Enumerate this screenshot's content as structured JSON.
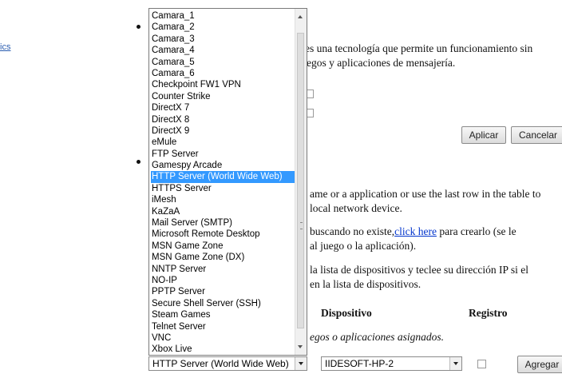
{
  "left_link": "ics",
  "paragraph1": {
    "line1": "es una tecnología que permite un funcionamiento sin",
    "line2": "egos y aplicaciones de mensajería."
  },
  "buttons": {
    "apply": "Aplicar",
    "cancel": "Cancelar",
    "add": "Agregar"
  },
  "paragraph2": {
    "line1": "ame or a application or use the last row in the table to",
    "line2": "local network device."
  },
  "paragraph3": {
    "line1_pre": "buscando no existe,",
    "link": "click here",
    "line1_post": " para crearlo (se le",
    "line2": "al juego o la aplicación)."
  },
  "paragraph4": {
    "line1": "la lista de dispositivos y teclee su dirección IP si el",
    "line2": "en la lista de dispositivos."
  },
  "table": {
    "headers": {
      "device": "Dispositivo",
      "log": "Registro"
    },
    "empty_message": "egos o aplicaciones asignados."
  },
  "application_select": {
    "value": "HTTP Server (World Wide Web)"
  },
  "device_select": {
    "value": "IIDESOFT-HP-2"
  },
  "dropdown": {
    "selected_index": 18,
    "options": [
      "Camara_1",
      "Camara_2",
      "Camara_3",
      "Camara_4",
      "Camara_5",
      "Camara_6",
      "Checkpoint FW1 VPN",
      "Counter Strike",
      "DirectX 7",
      "DirectX 8",
      "DirectX 9",
      "eMule",
      "FTP Server",
      "Gamespy Arcade",
      "HTTP Server (World Wide Web)",
      "HTTPS Server",
      "iMesh",
      "KaZaA",
      "Mail Server (SMTP)",
      "Microsoft Remote Desktop",
      "MSN Game Zone",
      "MSN Game Zone (DX)",
      "NNTP Server",
      "NO-IP",
      "PPTP Server",
      "Secure Shell Server (SSH)",
      "Steam Games",
      "Telnet Server",
      "VNC",
      "Xbox Live"
    ]
  }
}
